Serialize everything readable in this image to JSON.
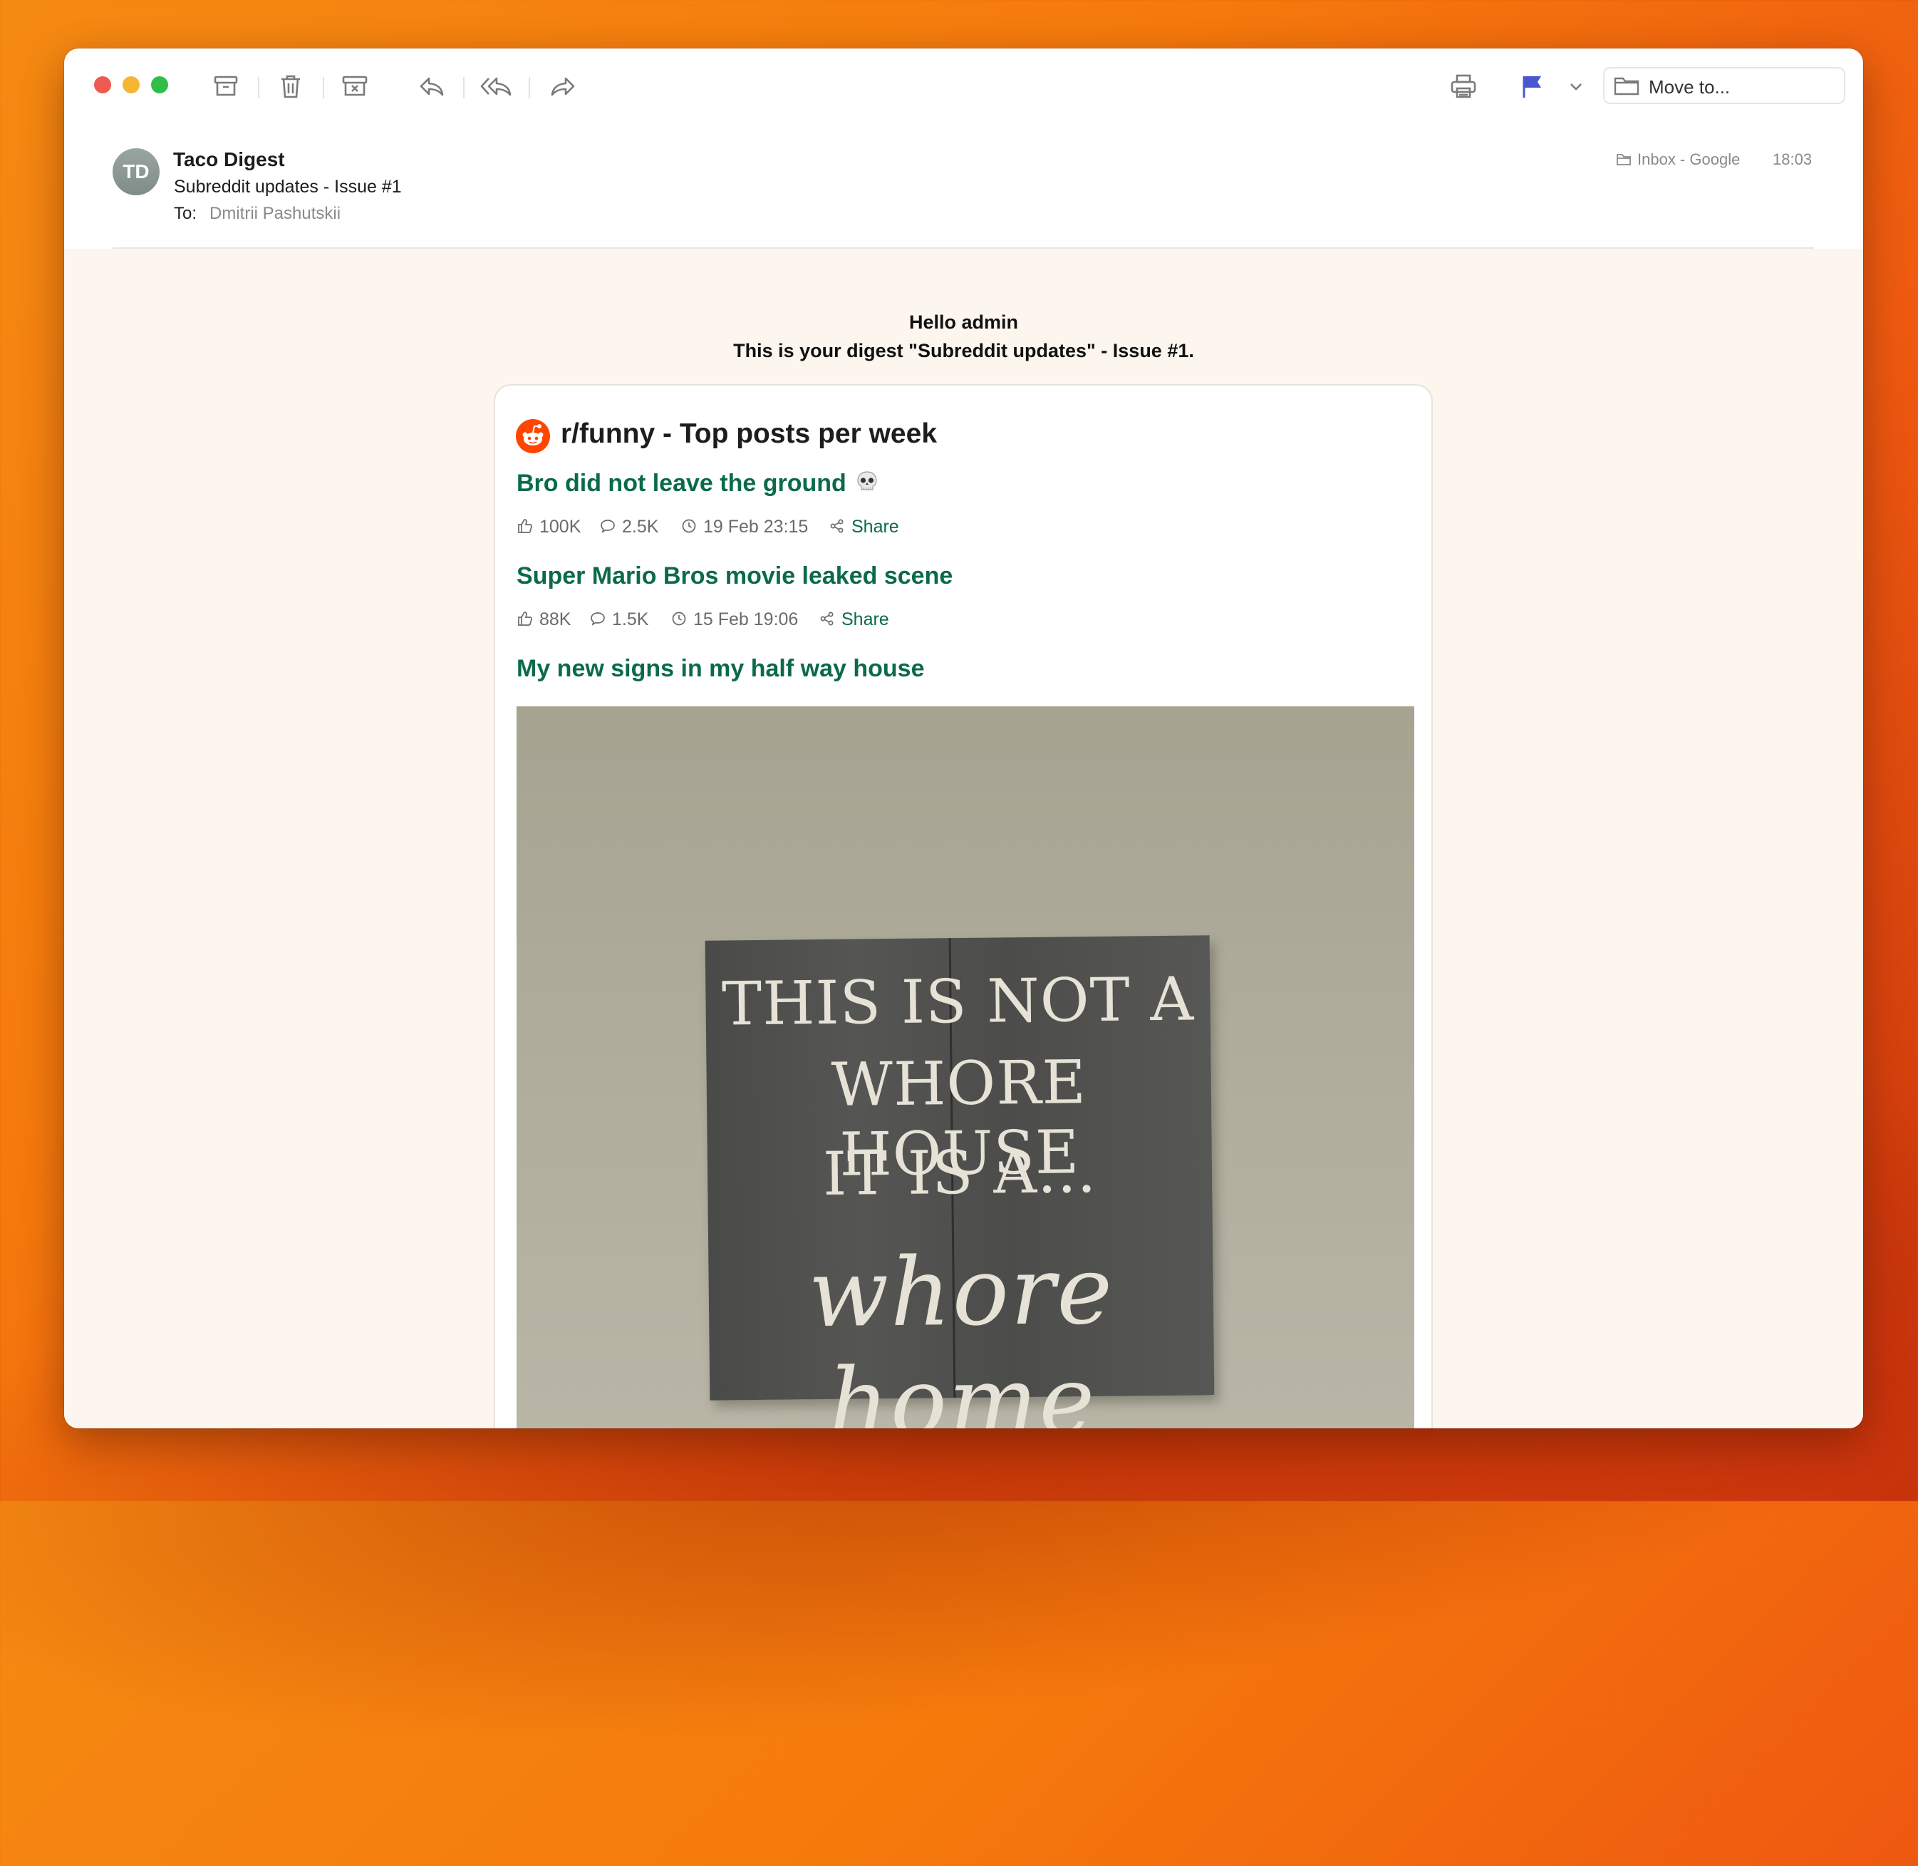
{
  "window": {
    "toolbar": {
      "move_to_label": "Move to...",
      "flag_color": "#4a55d1"
    },
    "message": {
      "avatar_initials": "TD",
      "sender": "Taco Digest",
      "subject": "Subreddit updates - Issue #1",
      "to_label": "To:",
      "to_value": "Dmitrii Pashutskii",
      "mailbox": "Inbox - Google",
      "time": "18:03"
    }
  },
  "email": {
    "greeting": "Hello admin",
    "intro": "This is your digest \"Subreddit updates\" - Issue #1.",
    "section_title": "r/funny - Top posts per week",
    "posts": [
      {
        "title": "Bro did not leave the ground",
        "emoji": "skull",
        "likes": "100K",
        "comments": "2.5K",
        "date": "19 Feb 23:15",
        "share": "Share"
      },
      {
        "title": "Super Mario Bros movie leaked scene",
        "likes": "88K",
        "comments": "1.5K",
        "date": "15 Feb 19:06",
        "share": "Share"
      },
      {
        "title": "My new signs in my half way house"
      }
    ],
    "image_sign": {
      "line1": "THIS IS NOT A",
      "line2": "WHORE HOUSE",
      "line3": "IT IS A...",
      "script": "whore home"
    }
  },
  "colors": {
    "link_green": "#0b6a4c",
    "reddit_orange": "#ff4500",
    "email_bg": "#fdf6ee"
  }
}
